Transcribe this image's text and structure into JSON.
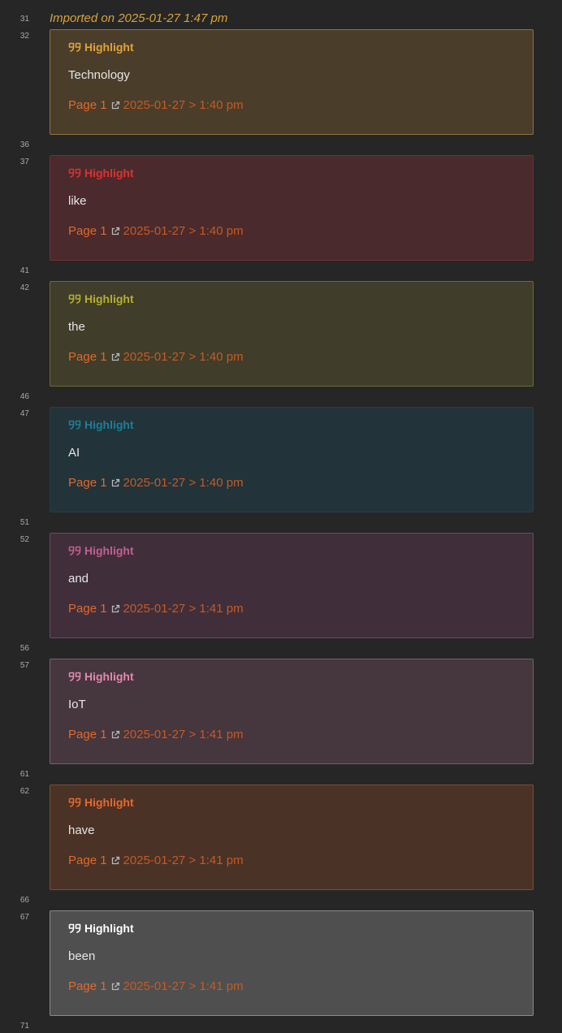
{
  "import_line": "Imported on 2025-01-27 1:47 pm",
  "line_numbers": {
    "l31": "31",
    "l32": "32",
    "l36": "36",
    "l37": "37",
    "l41": "41",
    "l42": "42",
    "l46": "46",
    "l47": "47",
    "l51": "51",
    "l52": "52",
    "l56": "56",
    "l57": "57",
    "l61": "61",
    "l62": "62",
    "l66": "66",
    "l67": "67",
    "l71": "71"
  },
  "highlights": [
    {
      "title": "Highlight",
      "text": "Technology",
      "page": "Page 1",
      "date": "2025-01-27 > 1:40 pm",
      "title_color": "#e0a33a",
      "bg": "#4a3d2a",
      "border": "#8a7440"
    },
    {
      "title": "Highlight",
      "text": "like",
      "page": "Page 1",
      "date": "2025-01-27 > 1:40 pm",
      "title_color": "#e0302f",
      "bg": "#4a2a2c",
      "border": "#6e3234"
    },
    {
      "title": "Highlight",
      "text": "the",
      "page": "Page 1",
      "date": "2025-01-27 > 1:40 pm",
      "title_color": "#b5b02a",
      "bg": "#403d2a",
      "border": "#6e6a35"
    },
    {
      "title": "Highlight",
      "text": "AI",
      "page": "Page 1",
      "date": "2025-01-27 > 1:40 pm",
      "title_color": "#1c7f95",
      "bg": "#22333a",
      "border": "#243f47"
    },
    {
      "title": "Highlight",
      "text": "and",
      "page": "Page 1",
      "date": "2025-01-27 > 1:41 pm",
      "title_color": "#c35f90",
      "bg": "#402f3b",
      "border": "#6a4a5c"
    },
    {
      "title": "Highlight",
      "text": "IoT",
      "page": "Page 1",
      "date": "2025-01-27 > 1:41 pm",
      "title_color": "#e289b0",
      "bg": "#46363d",
      "border": "#79626c"
    },
    {
      "title": "Highlight",
      "text": "have",
      "page": "Page 1",
      "date": "2025-01-27 > 1:41 pm",
      "title_color": "#e8682b",
      "bg": "#4a3226",
      "border": "#7e4d33"
    },
    {
      "title": "Highlight",
      "text": "been",
      "page": "Page 1",
      "date": "2025-01-27 > 1:41 pm",
      "title_color": "#ffffff",
      "bg": "#4f4f4f",
      "border": "#8a8a8a"
    }
  ],
  "icons": {
    "quote": "quote-icon",
    "external_link": "external-link-icon"
  }
}
